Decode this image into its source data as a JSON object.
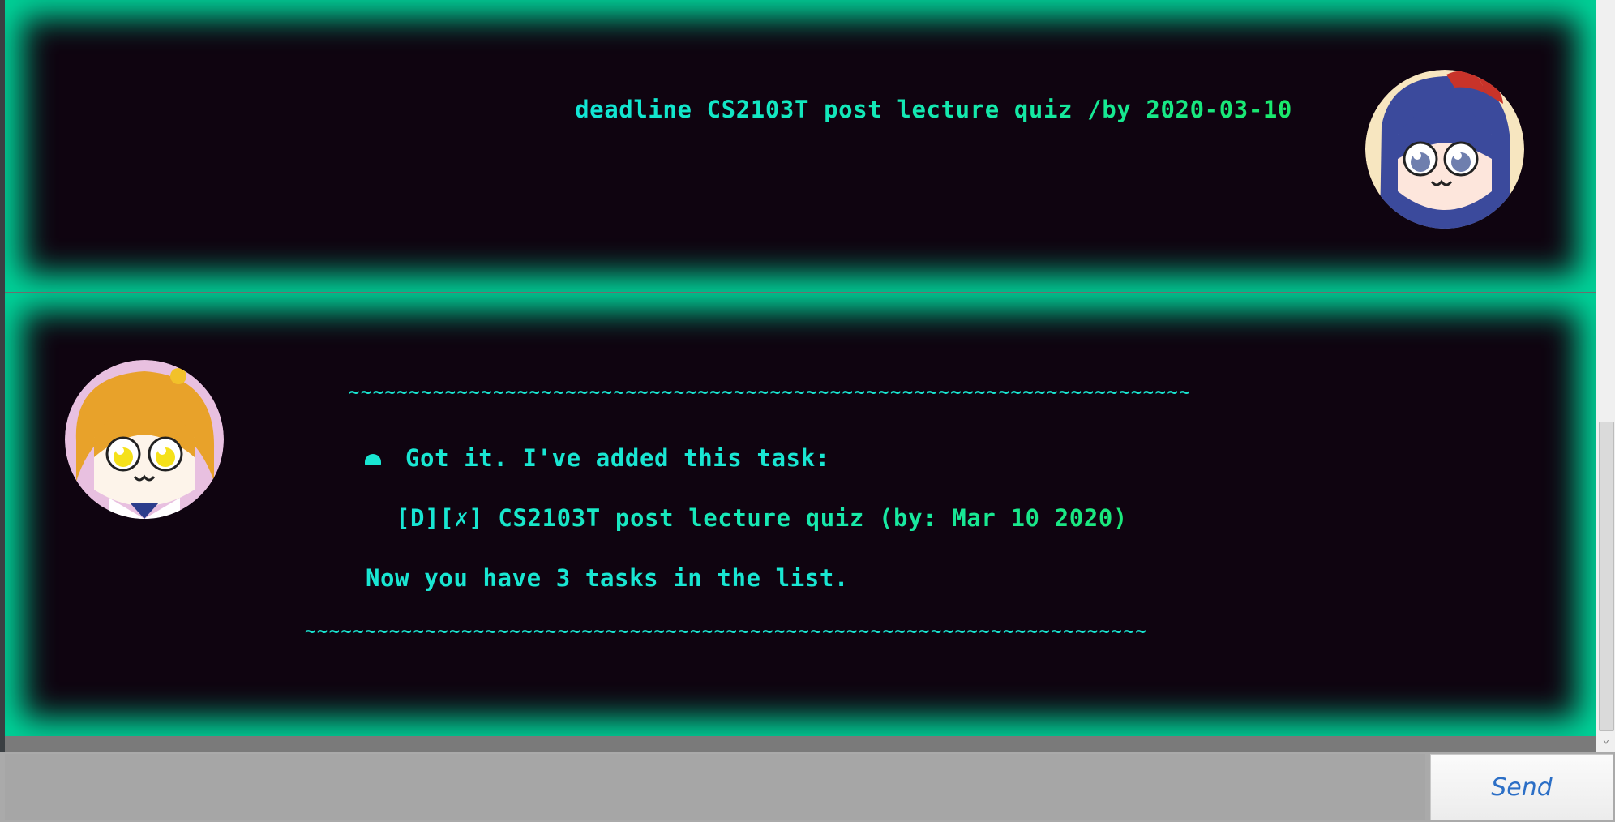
{
  "dialog": {
    "user_message": "deadline CS2103T post lecture quiz /by 2020-03-10",
    "bot_reply": {
      "divider_top": "~~~~~~~~~~~~~~~~~~~~~~~~~~~~~~~~~~~~~~~~~~~~~~~~~~~~~~~~~~~~~~~~~~~~~~",
      "acknowledgement": "Got it. I've added this task:",
      "task_line": "[D][✗] CS2103T post lecture quiz (by: Mar 10 2020)",
      "task_count_line": "Now you have 3 tasks in the list.",
      "divider_bottom": "~~~~~~~~~~~~~~~~~~~~~~~~~~~~~~~~~~~~~~~~~~~~~~~~~~~~~~~~~~~~~~~~~~~~~~"
    }
  },
  "input": {
    "value": "",
    "send_label": "Send"
  },
  "colors": {
    "bubble_glow": "#00d49a",
    "bubble_background": "#0f0410",
    "text_cyan": "#19e6d2",
    "send_label": "#2c6fc6"
  },
  "icons": {
    "user_avatar": "pipimi-avatar",
    "bot_avatar": "popuko-avatar",
    "bullet": "dome-bullet-icon"
  }
}
